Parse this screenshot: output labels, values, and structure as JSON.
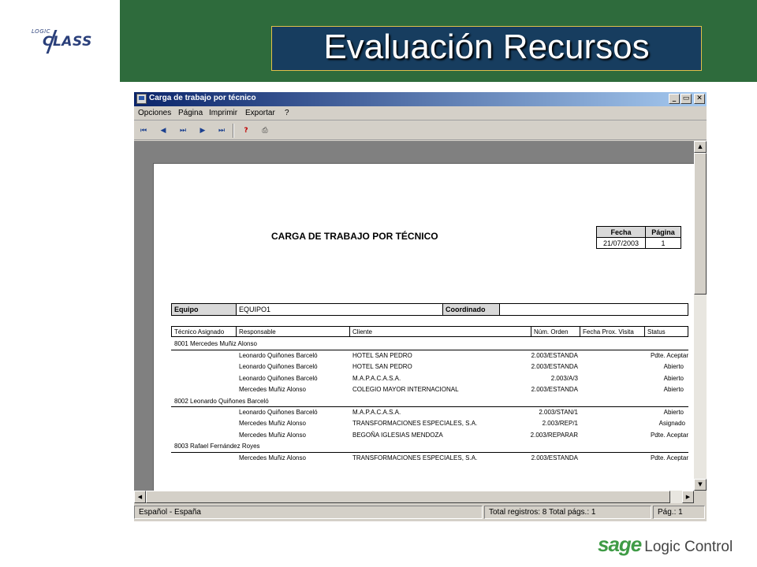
{
  "slide": {
    "title": "Evaluación Recursos",
    "logo": {
      "top": "LOGIC",
      "main": "CLASS"
    },
    "brand": {
      "sage": "sage",
      "rest": "Logic Control"
    }
  },
  "window": {
    "title": "Carga de trabajo por técnico",
    "controls": {
      "minimize": "_",
      "maximize": "▭",
      "close": "✕"
    },
    "menu": [
      "Opciones",
      "Página",
      "Imprimir",
      "Exportar",
      "?"
    ],
    "toolbar": {
      "first": "⏮",
      "prev": "◀",
      "goto": "⏭",
      "next": "▶",
      "last": "⏭",
      "help_print": "?",
      "print": "⎙"
    },
    "status": {
      "locale": "Español - España",
      "records": "Total registros: 8   Total págs.: 1",
      "page": "Pág.: 1"
    }
  },
  "report": {
    "title": "CARGA DE TRABAJO POR TÉCNICO",
    "header_box": {
      "labels": [
        "Fecha",
        "Página"
      ],
      "values": [
        "21/07/2003",
        "1"
      ]
    },
    "equipo_label": "Equipo",
    "equipo_value": "EQUIPO1",
    "coordinado_label": "Coordinado",
    "coordinado_value": "",
    "columns": [
      "Técnico Asignado",
      "Responsable",
      "Cliente",
      "Núm. Orden",
      "Fecha Prox. Visita",
      "Status"
    ],
    "groups": [
      {
        "technician": "8001 Mercedes Muñiz Alonso",
        "rows": [
          {
            "responsable": "Leonardo Quiñones Barceló",
            "cliente": "HOTEL SAN PEDRO",
            "orden": "2.003/ESTANDA",
            "status": "Pdte. Aceptar"
          },
          {
            "responsable": "Leonardo Quiñones Barceló",
            "cliente": "HOTEL SAN PEDRO",
            "orden": "2.003/ESTANDA",
            "status": "Abierto"
          },
          {
            "responsable": "Leonardo Quiñones Barceló",
            "cliente": "M.A.P.A.C.A.S.A.",
            "orden": "2.003/A/3",
            "status": "Abierto"
          },
          {
            "responsable": "Mercedes Muñiz Alonso",
            "cliente": "COLEGIO MAYOR INTERNACIONAL",
            "orden": "2.003/ESTANDA",
            "status": "Abierto"
          }
        ]
      },
      {
        "technician": "8002 Leonardo Quiñones Barceló",
        "rows": [
          {
            "responsable": "Leonardo Quiñones Barceló",
            "cliente": "M.A.P.A.C.A.S.A.",
            "orden": "2.003/STAN/1",
            "status": "Abierto"
          },
          {
            "responsable": "Mercedes Muñiz Alonso",
            "cliente": "TRANSFORMACIONES ESPECIALES, S.A.",
            "orden": "2.003/REP/1",
            "status": "Asignado"
          },
          {
            "responsable": "Mercedes Muñiz Alonso",
            "cliente": "BEGOÑA IGLESIAS MENDOZA",
            "orden": "2.003/REPARAR",
            "status": "Pdte. Aceptar"
          }
        ]
      },
      {
        "technician": "8003 Rafael Fernández Royes",
        "rows": [
          {
            "responsable": "Mercedes Muñiz Alonso",
            "cliente": "TRANSFORMACIONES ESPECIALES, S.A.",
            "orden": "2.003/ESTANDA",
            "status": "Pdte. Aceptar"
          }
        ]
      }
    ]
  }
}
